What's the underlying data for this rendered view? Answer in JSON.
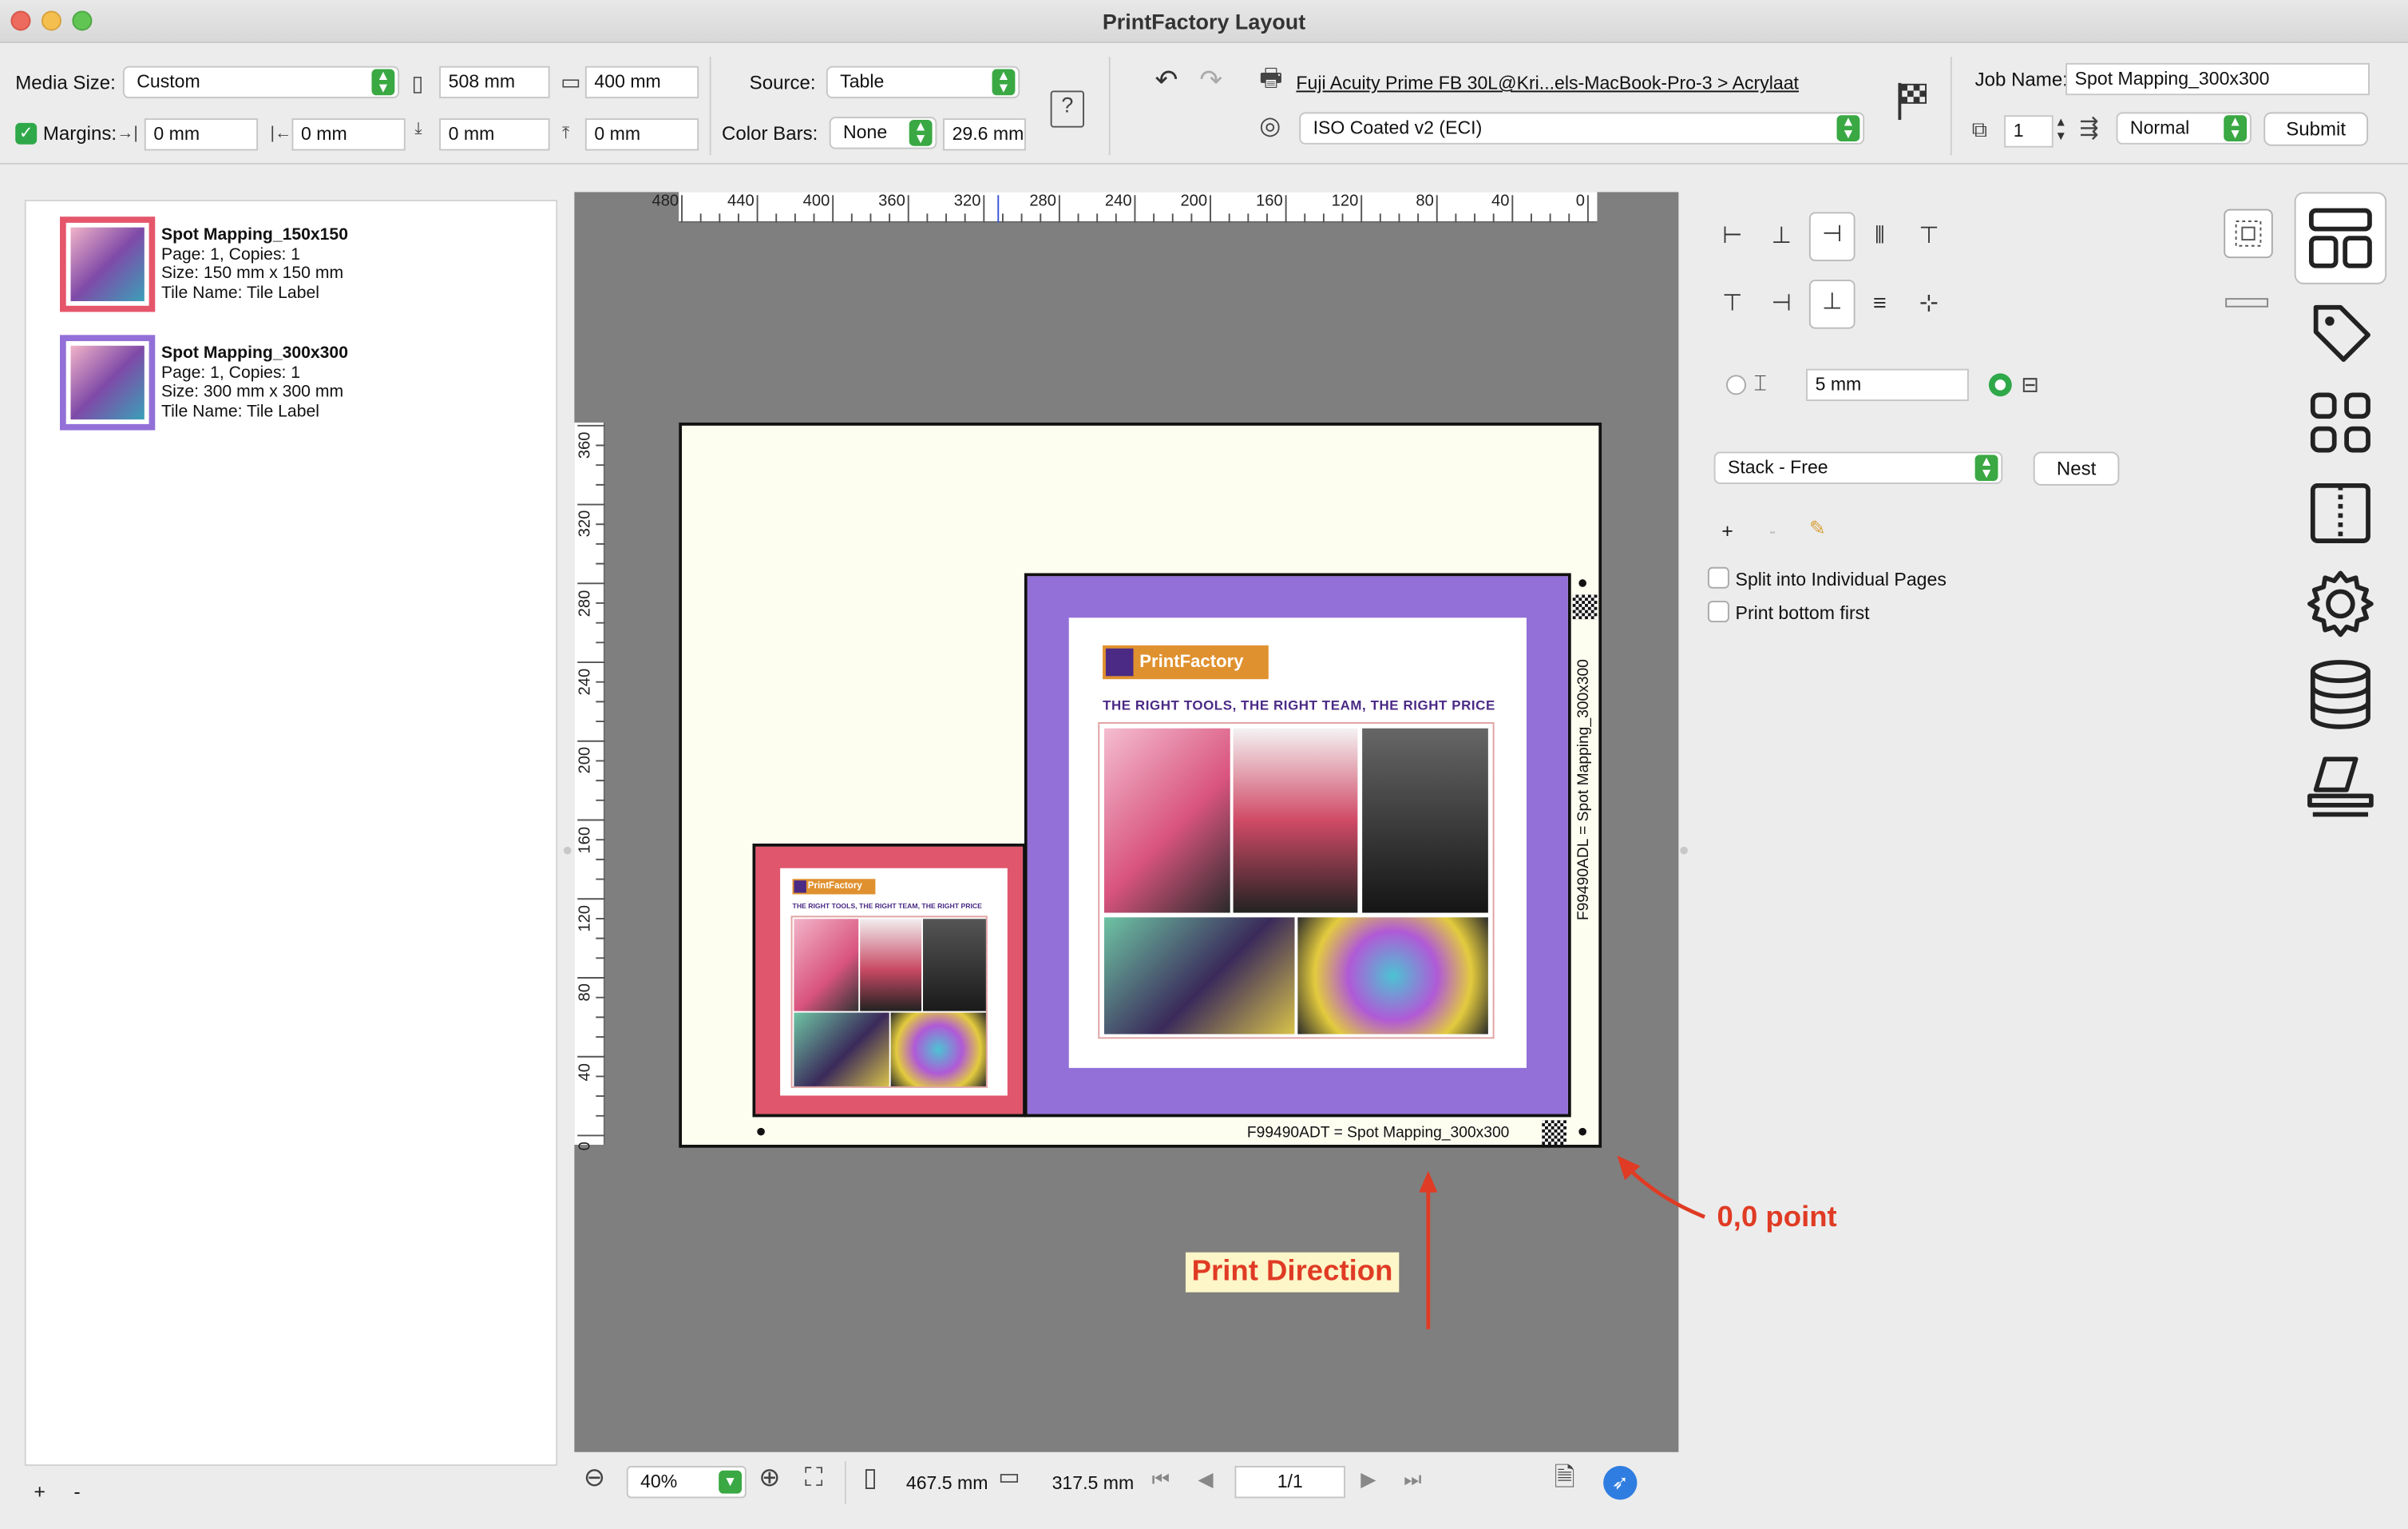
{
  "window": {
    "title": "PrintFactory Layout"
  },
  "toolbar": {
    "media_size_label": "Media Size:",
    "media_size_value": "Custom",
    "width_value": "508 mm",
    "height_value": "400 mm",
    "margins_label": "Margins:",
    "margin_right": "0 mm",
    "margin_left": "0 mm",
    "margin_bottom": "0 mm",
    "margin_top": "0 mm",
    "source_label": "Source:",
    "source_value": "Table",
    "color_bars_label": "Color Bars:",
    "color_bars_value": "None",
    "color_bars_size": "29.6 mm",
    "printer": "Fuji Acuity Prime FB 30L@Kri...els-MacBook-Pro-3 > Acrylaat",
    "profile": "ISO Coated v2 (ECI)",
    "job_name_label": "Job Name:",
    "job_name_value": "Spot Mapping_300x300",
    "copies_value": "1",
    "priority_value": "Normal",
    "submit_label": "Submit"
  },
  "jobs": [
    {
      "title": "Spot Mapping_150x150",
      "page": "Page: 1, Copies: 1",
      "size": "Size: 150 mm x 150 mm",
      "tile": "Tile Name: Tile Label",
      "border": "#e5566b"
    },
    {
      "title": "Spot Mapping_300x300",
      "page": "Page: 1, Copies: 1",
      "size": "Size: 300 mm x 300 mm",
      "tile": "Tile Name: Tile Label",
      "border": "#9270d8"
    }
  ],
  "sidebar": {
    "add_label": "+",
    "remove_label": "-"
  },
  "ruler": {
    "top_ticks": [
      "480",
      "440",
      "400",
      "360",
      "320",
      "280",
      "240",
      "200",
      "160",
      "120",
      "80",
      "40",
      "0"
    ],
    "left_ticks": [
      "360",
      "320",
      "280",
      "240",
      "200",
      "160",
      "120",
      "80",
      "40",
      "0"
    ]
  },
  "canvas": {
    "brand": "PrintFactory",
    "tagline": "THE RIGHT TOOLS, THE RIGHT TEAM, THE RIGHT PRICE",
    "tile_label_bottom": "F99490ADT = Spot Mapping_300x300",
    "tile_label_side": "F99490ADL = Spot Mapping_300x300",
    "small_color": "#e0566c",
    "large_color": "#9270d8"
  },
  "annotations": {
    "origin_label": "0,0 point",
    "direction_label": "Print Direction",
    "color": "#e03b24"
  },
  "right_panel": {
    "gap_value": "5 mm",
    "stack_value": "Stack - Free",
    "nest_label": "Nest",
    "add_label": "+",
    "remove_label": "-",
    "split_label": "Split into Individual Pages",
    "bottom_first_label": "Print bottom first"
  },
  "bottom_bar": {
    "zoom_value": "40%",
    "width_value": "467.5 mm",
    "height_value": "317.5 mm",
    "page_value": "1/1"
  }
}
